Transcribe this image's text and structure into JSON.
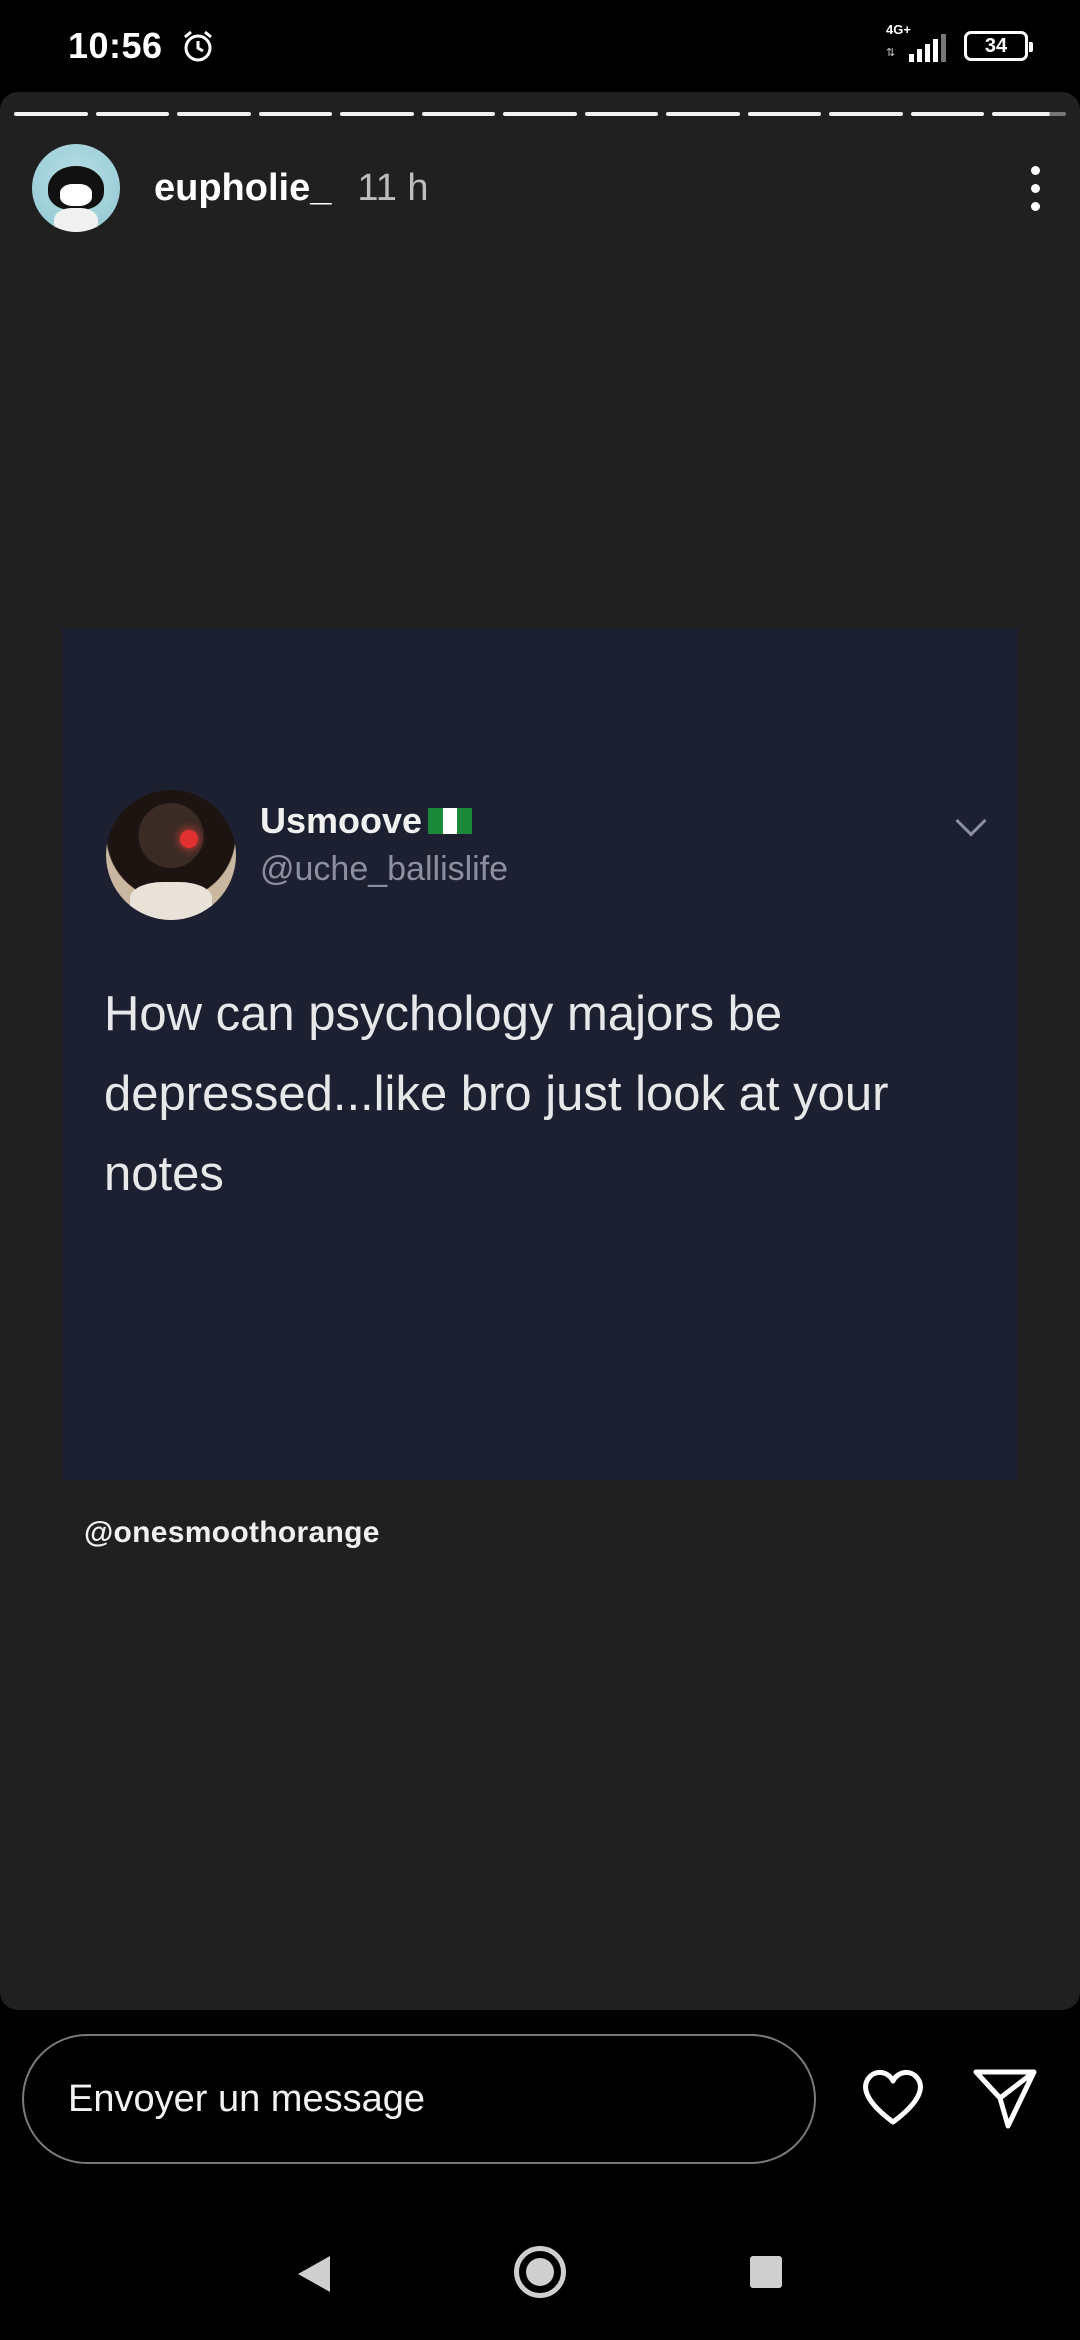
{
  "status_bar": {
    "time": "10:56",
    "network": "4G+",
    "battery": "34"
  },
  "story": {
    "username": "eupholie_",
    "time_ago": "11 h",
    "progress_segments": 13,
    "current_segment_progress": 0.78,
    "tweet": {
      "display_name": "Usmoove",
      "handle": "@uche_ballislife",
      "text": "How can psychology majors be depressed...like bro just look at your notes"
    },
    "mention": "@onesmoothorange"
  },
  "reply_bar": {
    "placeholder": "Envoyer un message"
  },
  "icons": {
    "alarm": "alarm-clock-icon",
    "like": "heart-icon",
    "send": "paper-plane-icon",
    "more": "more-vertical-icon"
  }
}
